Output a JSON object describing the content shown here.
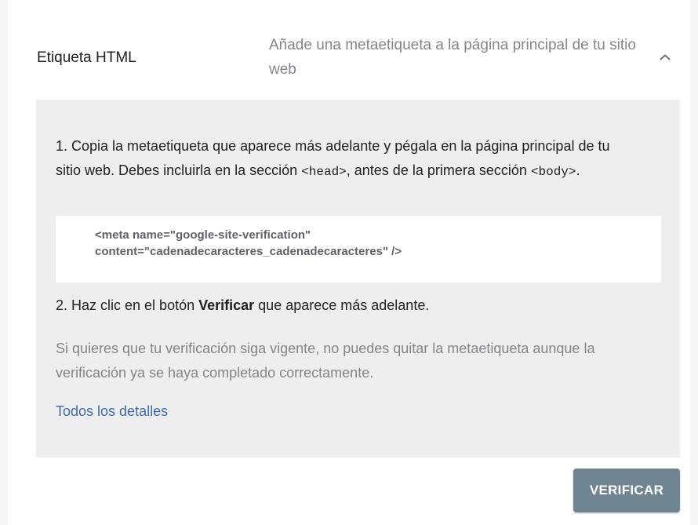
{
  "method": {
    "title": "Etiqueta HTML",
    "description": "Añade una metaetiqueta a la página principal de tu sitio web",
    "collapse_icon": "chevron-up-icon"
  },
  "instructions": {
    "step1": {
      "text_a": "1. Copia la metaetiqueta que aparece más adelante y pégala en la página principal de tu sitio web. Debes incluirla en la sección ",
      "code_head": "<head>",
      "text_b": ", antes de la primera sección ",
      "code_body": "<body>",
      "text_c": "."
    },
    "meta_tag": {
      "line1": "<meta name=\"google-site-verification\"",
      "line2": "content=\"cadenadecaracteres_cadenadecaracteres\" />"
    },
    "step2": {
      "text_a": "2. Haz clic en el botón ",
      "bold": "Verificar",
      "text_b": " que aparece más adelante."
    },
    "note": "Si quieres que tu verificación siga vigente, no puedes quitar la metaetiqueta aunque la verificación ya se haya completado correctamente.",
    "details_link": "Todos los detalles"
  },
  "actions": {
    "verify_label": "VERIFICAR"
  },
  "colors": {
    "panel_bg": "#eeeeee",
    "link": "#3c6aa8",
    "button_bg": "#6f8592",
    "muted_text": "#80868b"
  }
}
